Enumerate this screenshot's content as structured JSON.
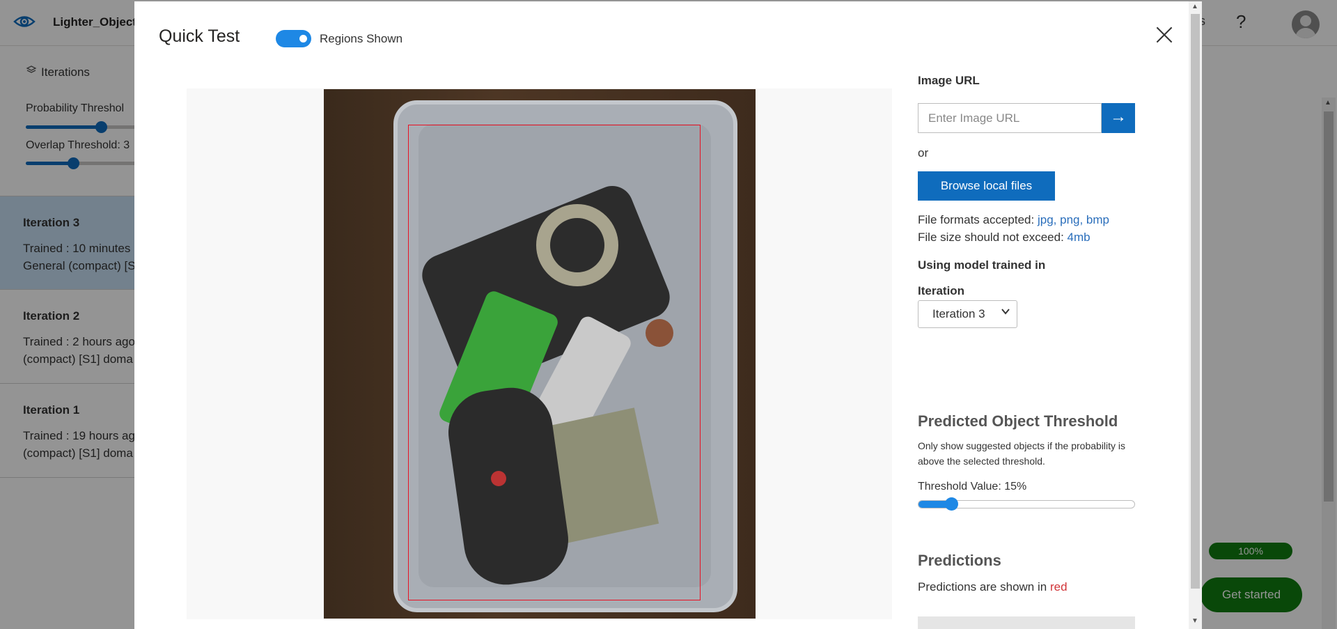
{
  "app": {
    "title": "Lighter_Object",
    "help_label": "?",
    "edge_letter": "s"
  },
  "sidebar": {
    "iterations_label": "Iterations",
    "probability_label": "Probability Threshol",
    "probability_value": 0.6,
    "overlap_label": "Overlap Threshold: 3",
    "overlap_value": 0.38,
    "items": [
      {
        "name": "Iteration 3",
        "line1": "Trained : 10 minutes",
        "line2": "General (compact) [S",
        "active": true
      },
      {
        "name": "Iteration 2",
        "line1": "Trained : 2 hours ago",
        "line2": "(compact) [S1] doma",
        "active": false
      },
      {
        "name": "Iteration 1",
        "line1": "Trained : 19 hours ag",
        "line2": "(compact) [S1] doma",
        "active": false
      }
    ]
  },
  "background": {
    "progress_badge": "100%",
    "get_started": "Get started"
  },
  "modal": {
    "title": "Quick Test",
    "toggle_on": true,
    "toggle_label": "Regions Shown",
    "image_url_label": "Image URL",
    "image_url_placeholder": "Enter Image URL",
    "image_url_value": "",
    "or_label": "or",
    "browse_label": "Browse local files",
    "formats_prefix": "File formats accepted:",
    "formats_value": "jpg, png, bmp",
    "size_prefix": "File size should not exceed:",
    "size_value": "4mb",
    "model_label": "Using model trained in",
    "iteration_label": "Iteration",
    "iteration_selected": "Iteration 3",
    "threshold_heading": "Predicted Object Threshold",
    "threshold_desc": "Only show suggested objects if the probability is above the selected threshold.",
    "threshold_label": "Threshold Value: 15%",
    "threshold_value": 0.15,
    "predictions_heading": "Predictions",
    "predictions_prefix": "Predictions are shown in",
    "predictions_color_word": "red",
    "prediction_color": "#e81123"
  },
  "colors": {
    "accent": "#0f6cbd",
    "toggle": "#1e88e5",
    "selected_iteration": "#c7dff3",
    "success": "#107c10"
  }
}
